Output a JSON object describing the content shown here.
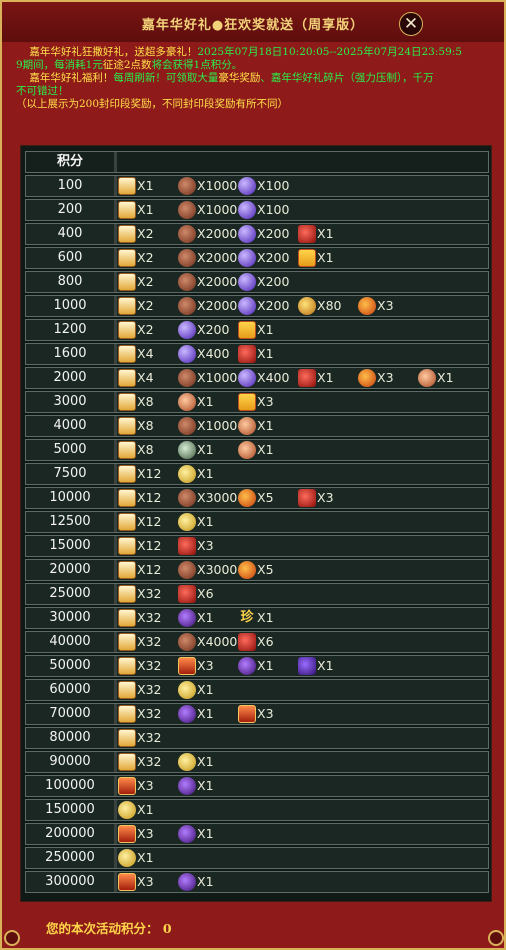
{
  "window": {
    "title": "嘉年华好礼●狂欢奖就送（周享版）",
    "close_label": "✕"
  },
  "info": {
    "line1_a": "嘉年华好礼狂撒好礼，送超多豪礼！",
    "line1_b": "2025年07月18日10:20:05--2025年07月24日23:59:5",
    "line2_a": "9期间，每消耗1元",
    "line2_b": "征途2点数",
    "line2_c": "将会获得1点积分。",
    "line3_a": "嘉年华好礼福利！",
    "line3_b": "每周刷新！可领取大量",
    "line3_c": "豪华奖励",
    "line3_d": "、嘉年华好礼碎片（强力压制），千万",
    "line4": "不可错过！",
    "line5": "（以上展示为200封印段奖励，不同封印段奖励有所不同）"
  },
  "table": {
    "header": "积分",
    "rows": [
      {
        "score": "100",
        "items": [
          {
            "icon": "scroll-icon",
            "qty": "X1"
          },
          {
            "icon": "ore-icon",
            "qty": "X1000"
          },
          {
            "icon": "gem-icon",
            "qty": "X100"
          }
        ]
      },
      {
        "score": "200",
        "items": [
          {
            "icon": "scroll-icon",
            "qty": "X1"
          },
          {
            "icon": "ore-icon",
            "qty": "X1000"
          },
          {
            "icon": "gem-icon",
            "qty": "X100"
          }
        ]
      },
      {
        "score": "400",
        "items": [
          {
            "icon": "scroll-icon",
            "qty": "X2"
          },
          {
            "icon": "ore-icon",
            "qty": "X2000"
          },
          {
            "icon": "gem-icon",
            "qty": "X200"
          },
          {
            "icon": "box-icon",
            "qty": "X1"
          }
        ]
      },
      {
        "score": "600",
        "items": [
          {
            "icon": "scroll-icon",
            "qty": "X2"
          },
          {
            "icon": "ore-icon",
            "qty": "X2000"
          },
          {
            "icon": "gem-icon",
            "qty": "X200"
          },
          {
            "icon": "gift-icon",
            "qty": "X1"
          }
        ]
      },
      {
        "score": "800",
        "items": [
          {
            "icon": "scroll-icon",
            "qty": "X2"
          },
          {
            "icon": "ore-icon",
            "qty": "X2000"
          },
          {
            "icon": "gem-icon",
            "qty": "X200"
          }
        ]
      },
      {
        "score": "1000",
        "items": [
          {
            "icon": "scroll-icon",
            "qty": "X2"
          },
          {
            "icon": "ore-icon",
            "qty": "X2000"
          },
          {
            "icon": "gem-icon",
            "qty": "X200"
          },
          {
            "icon": "coin-icon",
            "qty": "X80"
          },
          {
            "icon": "flame-orb-icon",
            "qty": "X3"
          }
        ]
      },
      {
        "score": "1200",
        "items": [
          {
            "icon": "scroll-icon",
            "qty": "X2"
          },
          {
            "icon": "gem-icon",
            "qty": "X200"
          },
          {
            "icon": "gift-icon",
            "qty": "X1"
          }
        ]
      },
      {
        "score": "1600",
        "items": [
          {
            "icon": "scroll-icon",
            "qty": "X4"
          },
          {
            "icon": "gem-icon",
            "qty": "X400"
          },
          {
            "icon": "box-icon",
            "qty": "X1"
          }
        ]
      },
      {
        "score": "2000",
        "items": [
          {
            "icon": "scroll-icon",
            "qty": "X4"
          },
          {
            "icon": "ore-icon",
            "qty": "X1000"
          },
          {
            "icon": "gem-icon",
            "qty": "X400"
          },
          {
            "icon": "box-icon",
            "qty": "X1"
          },
          {
            "icon": "flame-orb-icon",
            "qty": "X3"
          },
          {
            "icon": "orb-icon",
            "qty": "X1"
          }
        ]
      },
      {
        "score": "3000",
        "items": [
          {
            "icon": "scroll-icon",
            "qty": "X8"
          },
          {
            "icon": "orb-icon",
            "qty": "X1"
          },
          {
            "icon": "gift-icon",
            "qty": "X3"
          }
        ]
      },
      {
        "score": "4000",
        "items": [
          {
            "icon": "scroll-icon",
            "qty": "X8"
          },
          {
            "icon": "ore-icon",
            "qty": "X1000"
          },
          {
            "icon": "orb-icon",
            "qty": "X1"
          }
        ]
      },
      {
        "score": "5000",
        "items": [
          {
            "icon": "scroll-icon",
            "qty": "X8"
          },
          {
            "icon": "seal-icon",
            "qty": "X1"
          },
          {
            "icon": "orb-icon",
            "qty": "X1"
          }
        ]
      },
      {
        "score": "7500",
        "items": [
          {
            "icon": "scroll-icon",
            "qty": "X12"
          },
          {
            "icon": "golden-orb-icon",
            "qty": "X1"
          }
        ]
      },
      {
        "score": "10000",
        "items": [
          {
            "icon": "scroll-icon",
            "qty": "X12"
          },
          {
            "icon": "ore-icon",
            "qty": "X3000"
          },
          {
            "icon": "flame-orb-icon",
            "qty": "X5"
          },
          {
            "icon": "box-icon",
            "qty": "X3"
          }
        ]
      },
      {
        "score": "12500",
        "items": [
          {
            "icon": "scroll-icon",
            "qty": "X12"
          },
          {
            "icon": "golden-orb-icon",
            "qty": "X1"
          }
        ]
      },
      {
        "score": "15000",
        "items": [
          {
            "icon": "scroll-icon",
            "qty": "X12"
          },
          {
            "icon": "box-icon",
            "qty": "X3"
          }
        ]
      },
      {
        "score": "20000",
        "items": [
          {
            "icon": "scroll-icon",
            "qty": "X12"
          },
          {
            "icon": "ore-icon",
            "qty": "X3000"
          },
          {
            "icon": "flame-orb-icon",
            "qty": "X5"
          }
        ]
      },
      {
        "score": "25000",
        "items": [
          {
            "icon": "scroll-icon",
            "qty": "X32"
          },
          {
            "icon": "box-icon",
            "qty": "X6"
          }
        ]
      },
      {
        "score": "30000",
        "items": [
          {
            "icon": "scroll-icon",
            "qty": "X32"
          },
          {
            "icon": "purple-orb-icon",
            "qty": "X1"
          },
          {
            "icon": "zhen-icon",
            "glyph": "珍",
            "qty": "X1"
          }
        ]
      },
      {
        "score": "40000",
        "items": [
          {
            "icon": "scroll-icon",
            "qty": "X32"
          },
          {
            "icon": "ore-icon",
            "qty": "X4000"
          },
          {
            "icon": "box-icon",
            "qty": "X6"
          }
        ]
      },
      {
        "score": "50000",
        "items": [
          {
            "icon": "scroll-icon",
            "qty": "X32"
          },
          {
            "icon": "talisman-icon",
            "qty": "X3"
          },
          {
            "icon": "purple-orb-icon",
            "qty": "X1"
          },
          {
            "icon": "gem-cube-icon",
            "qty": "X1"
          }
        ]
      },
      {
        "score": "60000",
        "items": [
          {
            "icon": "scroll-icon",
            "qty": "X32"
          },
          {
            "icon": "golden-orb-icon",
            "qty": "X1"
          }
        ]
      },
      {
        "score": "70000",
        "items": [
          {
            "icon": "scroll-icon",
            "qty": "X32"
          },
          {
            "icon": "purple-orb-icon",
            "qty": "X1"
          },
          {
            "icon": "talisman-icon",
            "qty": "X3"
          }
        ]
      },
      {
        "score": "80000",
        "items": [
          {
            "icon": "scroll-icon",
            "qty": "X32"
          }
        ]
      },
      {
        "score": "90000",
        "items": [
          {
            "icon": "scroll-icon",
            "qty": "X32"
          },
          {
            "icon": "golden-orb-icon",
            "qty": "X1"
          }
        ]
      },
      {
        "score": "100000",
        "items": [
          {
            "icon": "talisman-icon",
            "qty": "X3"
          },
          {
            "icon": "purple-orb-icon",
            "qty": "X1"
          }
        ]
      },
      {
        "score": "150000",
        "items": [
          {
            "icon": "golden-orb-icon",
            "qty": "X1"
          }
        ]
      },
      {
        "score": "200000",
        "items": [
          {
            "icon": "talisman-icon",
            "qty": "X3"
          },
          {
            "icon": "purple-orb-icon",
            "qty": "X1"
          }
        ]
      },
      {
        "score": "250000",
        "items": [
          {
            "icon": "golden-orb-icon",
            "qty": "X1"
          }
        ]
      },
      {
        "score": "300000",
        "items": [
          {
            "icon": "talisman-icon",
            "qty": "X3"
          },
          {
            "icon": "purple-orb-icon",
            "qty": "X1"
          }
        ]
      }
    ]
  },
  "footer": {
    "my_score_label": "您的本次活动积分：",
    "my_score_value": "0"
  }
}
